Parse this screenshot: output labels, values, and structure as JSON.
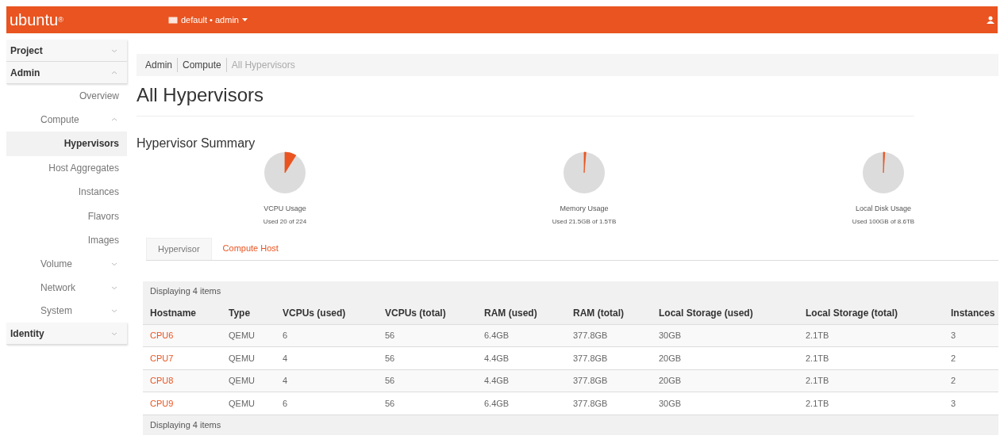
{
  "header": {
    "logo": "ubuntu",
    "logo_mark": "®",
    "project_menu": "default • admin"
  },
  "sidebar": {
    "items": [
      {
        "label": "Project",
        "expanded": false
      },
      {
        "label": "Admin",
        "expanded": true,
        "children": [
          {
            "label": "Overview",
            "selected": false
          },
          {
            "label": "Compute",
            "expanded": true,
            "children": [
              {
                "label": "Hypervisors",
                "selected": true
              },
              {
                "label": "Host Aggregates",
                "selected": false
              },
              {
                "label": "Instances",
                "selected": false
              },
              {
                "label": "Flavors",
                "selected": false
              },
              {
                "label": "Images",
                "selected": false
              }
            ]
          },
          {
            "label": "Volume",
            "expanded": false
          },
          {
            "label": "Network",
            "expanded": false
          },
          {
            "label": "System",
            "expanded": false
          }
        ]
      },
      {
        "label": "Identity",
        "expanded": false
      }
    ]
  },
  "breadcrumb": [
    "Admin",
    "Compute",
    "All Hypervisors"
  ],
  "page_title": "All Hypervisors",
  "summary": {
    "title": "Hypervisor Summary",
    "charts": [
      {
        "label": "VCPU Usage",
        "reading": "Used 20 of 224"
      },
      {
        "label": "Memory Usage",
        "reading": "Used 21.5GB of 1.5TB"
      },
      {
        "label": "Local Disk Usage",
        "reading": "Used 100GB of 8.6TB"
      }
    ]
  },
  "tabs": [
    {
      "label": "Hypervisor",
      "selected": true
    },
    {
      "label": "Compute Host",
      "selected": false
    }
  ],
  "table": {
    "count_top": "Displaying 4 items",
    "count_bottom": "Displaying 4 items",
    "columns": [
      "Hostname",
      "Type",
      "VCPUs (used)",
      "VCPUs (total)",
      "RAM (used)",
      "RAM (total)",
      "Local Storage (used)",
      "Local Storage (total)",
      "Instances"
    ],
    "rows": [
      [
        "CPU6",
        "QEMU",
        "6",
        "56",
        "6.4GB",
        "377.8GB",
        "30GB",
        "2.1TB",
        "3"
      ],
      [
        "CPU7",
        "QEMU",
        "4",
        "56",
        "4.4GB",
        "377.8GB",
        "20GB",
        "2.1TB",
        "2"
      ],
      [
        "CPU8",
        "QEMU",
        "4",
        "56",
        "4.4GB",
        "377.8GB",
        "20GB",
        "2.1TB",
        "2"
      ],
      [
        "CPU9",
        "QEMU",
        "6",
        "56",
        "6.4GB",
        "377.8GB",
        "30GB",
        "2.1TB",
        "3"
      ]
    ]
  }
}
